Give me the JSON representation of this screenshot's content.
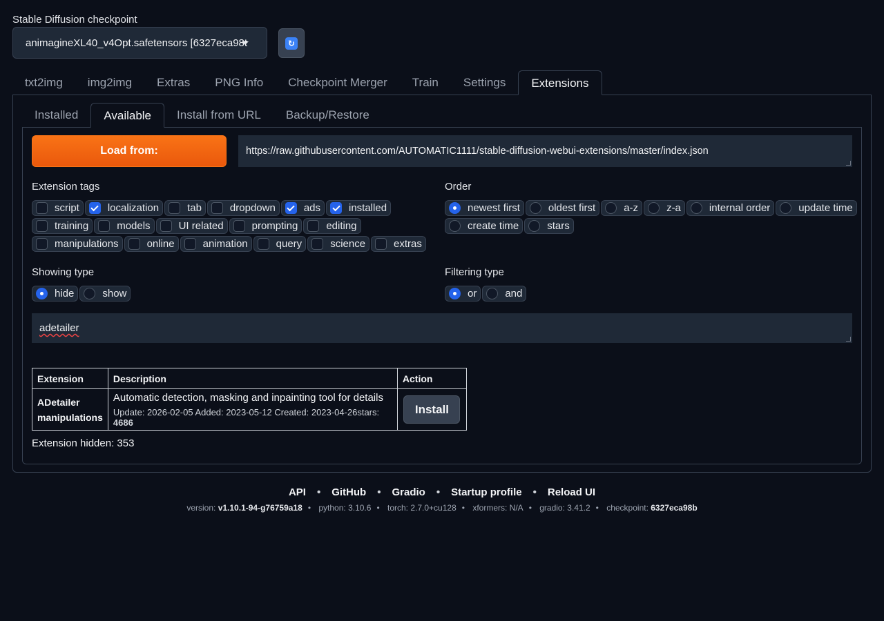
{
  "checkpoint": {
    "label": "Stable Diffusion checkpoint",
    "value": "animagineXL40_v4Opt.safetensors [6327eca98t"
  },
  "main_tabs": [
    "txt2img",
    "img2img",
    "Extras",
    "PNG Info",
    "Checkpoint Merger",
    "Train",
    "Settings",
    "Extensions"
  ],
  "active_main_tab": "Extensions",
  "sub_tabs": [
    "Installed",
    "Available",
    "Install from URL",
    "Backup/Restore"
  ],
  "active_sub_tab": "Available",
  "load_button": "Load from:",
  "index_url": "https://raw.githubusercontent.com/AUTOMATIC1111/stable-diffusion-webui-extensions/master/index.json",
  "extension_tags": {
    "label": "Extension tags",
    "rows": [
      [
        {
          "label": "script",
          "checked": false
        },
        {
          "label": "localization",
          "checked": true
        },
        {
          "label": "tab",
          "checked": false
        },
        {
          "label": "dropdown",
          "checked": false
        },
        {
          "label": "ads",
          "checked": true
        },
        {
          "label": "installed",
          "checked": true
        }
      ],
      [
        {
          "label": "training",
          "checked": false
        },
        {
          "label": "models",
          "checked": false
        },
        {
          "label": "UI related",
          "checked": false
        },
        {
          "label": "prompting",
          "checked": false
        },
        {
          "label": "editing",
          "checked": false
        }
      ],
      [
        {
          "label": "manipulations",
          "checked": false
        },
        {
          "label": "online",
          "checked": false
        },
        {
          "label": "animation",
          "checked": false
        },
        {
          "label": "query",
          "checked": false
        },
        {
          "label": "science",
          "checked": false
        },
        {
          "label": "extras",
          "checked": false
        }
      ]
    ]
  },
  "order": {
    "label": "Order",
    "rows": [
      [
        {
          "label": "newest first",
          "selected": true
        },
        {
          "label": "oldest first",
          "selected": false
        },
        {
          "label": "a-z",
          "selected": false
        },
        {
          "label": "z-a",
          "selected": false
        },
        {
          "label": "internal order",
          "selected": false
        },
        {
          "label": "update time",
          "selected": false
        }
      ],
      [
        {
          "label": "create time",
          "selected": false
        },
        {
          "label": "stars",
          "selected": false
        }
      ]
    ]
  },
  "showing_type": {
    "label": "Showing type",
    "options": [
      {
        "label": "hide",
        "selected": true
      },
      {
        "label": "show",
        "selected": false
      }
    ]
  },
  "filtering_type": {
    "label": "Filtering type",
    "options": [
      {
        "label": "or",
        "selected": true
      },
      {
        "label": "and",
        "selected": false
      }
    ]
  },
  "search_value": "adetailer",
  "table": {
    "headers": [
      "Extension",
      "Description",
      "Action"
    ],
    "row": {
      "name": "ADetailer",
      "tag": "manipulations",
      "description": "Automatic detection, masking and inpainting tool for details",
      "meta": "Update: 2026-02-05 Added: 2023-05-12 Created: 2023-04-26stars: ",
      "stars": "4686",
      "action": "Install"
    }
  },
  "hidden_count": "Extension hidden: 353",
  "footer": {
    "links": [
      "API",
      "GitHub",
      "Gradio",
      "Startup profile",
      "Reload UI"
    ],
    "version_label": "version:",
    "version": "v1.10.1-94-g76759a18",
    "python_label": "python:",
    "python": "3.10.6",
    "torch_label": "torch:",
    "torch": "2.7.0+cu128",
    "xformers_label": "xformers:",
    "xformers": "N/A",
    "gradio_label": "gradio:",
    "gradio": "3.41.2",
    "checkpoint_label": "checkpoint:",
    "checkpoint": "6327eca98b"
  },
  "colors": {
    "accent": "#f97316",
    "primary": "#2563eb",
    "background": "#0b0f19"
  }
}
